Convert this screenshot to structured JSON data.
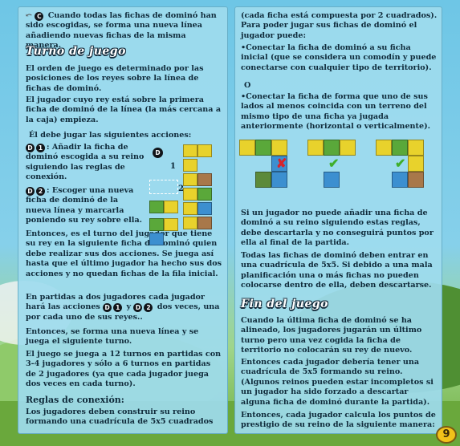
{
  "left": {
    "para_c": "Cuando todas las fichas de dominó han sido escogidas, se forma una nueva línea añadiendo nuevas fichas de la misma manera.",
    "para_c_prefix": "C",
    "heading_turno": "Turno de juego",
    "p_orden": "El orden de juego es determinado por las posiciones de los reyes sobre la línea de fichas de dominó.",
    "p_jugador": "El jugador cuyo rey está sobre la primera ficha de dominó de la línea (la más cercana a la caja) empieza.",
    "p_debe": "Él debe jugar las siguientes acciones:",
    "p_d1": ": Añadir la ficha de dominó escogida a su reino siguiendo las reglas de conexión.",
    "p_d2": ": Escoger una nueva ficha de dominó de la nueva línea y marcarla poniendo su rey sobre ella.",
    "p_entonces": "Entonces, es el turno del jugador que tiene su rey en la siguiente ficha de dominó quien debe realizar sus dos acciones. Se juega así hasta que el último jugador ha hecho sus dos acciones y no quedan fichas de la fila inicial.",
    "p_partidas": "En partidas a dos jugadores cada jugador hará las acciones",
    "p_partidas_mid": "y",
    "p_partidas_end": "dos veces, una por cada uno de sus reyes..",
    "p_entonces2": "Entonces, se forma una nueva línea y se juega el siguiente turno.",
    "p_juego12": "El juego se juega a 12 turnos en partidas con 3-4 jugadores y sólo a 6 turnos en partidas de 2 jugadores (ya que cada jugador juega dos veces en cada turno).",
    "heading_reglas": "Reglas de conexión:",
    "p_reglas": "Los jugadores deben construir su reino formando una cuadrícula de 5x5 cuadrados",
    "diagram_label": "D",
    "diagram_1": "1",
    "diagram_2": "2",
    "badge_d": "D",
    "badge_1": "1",
    "badge_2": "2"
  },
  "right": {
    "p_cada": "(cada ficha está compuesta por 2 cuadrados). Para poder jugar sus fichas de dominó el jugador puede:",
    "bullet_1": "•Conectar la ficha de dominó a su ficha inicial (que se considera un comodín y puede conectarse con cualquier tipo de territorio).",
    "or_label": "O",
    "bullet_2": "•Conectar la ficha de forma que uno de sus lados al menos coincida con un terreno del mismo tipo de una ficha ya jugada anteriormente (horizontal o verticalmente).",
    "p_si_no": "Si un jugador no puede añadir una ficha de dominó a su reino siguiendo estas reglas, debe descartarla y no conseguirá puntos por ella al final de la partida.",
    "p_todas": "Todas las fichas de dominó deben entrar en una cuadrícula de 5x5. Si debido a una mala planificación una o más fichas no pueden colocarse dentro de ella, deben descartarse.",
    "heading_fin": "Fin del juego",
    "p_fin1": "Cuando la última ficha de dominó se ha alineado, los jugadores jugarán un último turno pero una vez cogida la ficha de territorio no colocarán su rey de nuevo.",
    "p_fin2": "Entonces cada jugador debería tener una cuadrícula de 5x5 formando su reino. (Algunos reinos pueden estar incompletos si un jugador ha sido forzado a descartar alguna ficha de dominó durante la partida).",
    "p_fin3": "Entonces, cada jugador calcula los puntos de prestigio de su reino de la siguiente manera:",
    "mark_wrong": "✘",
    "mark_right": "✔"
  },
  "page_number": "9",
  "colors": {
    "panel": "#9edbee",
    "text": "#0f2a3a",
    "wheat": "#e8d22c",
    "forest": "#5aa83a",
    "water": "#3c8fd0",
    "wrong": "#d8232a",
    "right": "#3fae2a"
  }
}
